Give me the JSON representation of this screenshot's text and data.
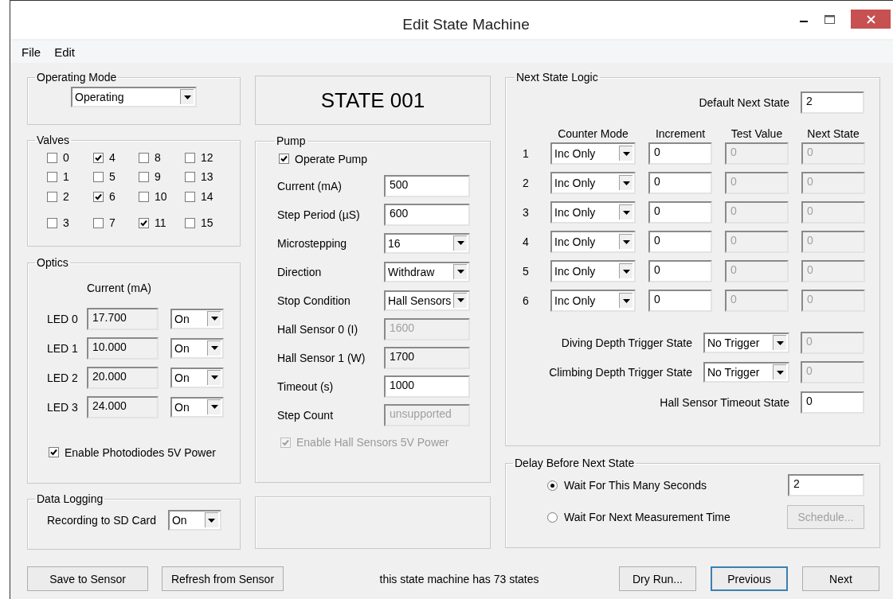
{
  "window": {
    "title": "Edit State Machine"
  },
  "menu": [
    "File",
    "Edit"
  ],
  "operating_mode": {
    "title": "Operating Mode",
    "value": "Operating"
  },
  "valves": {
    "title": "Valves",
    "items": [
      {
        "label": "0",
        "checked": false
      },
      {
        "label": "1",
        "checked": false
      },
      {
        "label": "2",
        "checked": false
      },
      {
        "label": "3",
        "checked": false
      },
      {
        "label": "4",
        "checked": true
      },
      {
        "label": "5",
        "checked": false
      },
      {
        "label": "6",
        "checked": true
      },
      {
        "label": "7",
        "checked": false
      },
      {
        "label": "8",
        "checked": false
      },
      {
        "label": "9",
        "checked": false
      },
      {
        "label": "10",
        "checked": false
      },
      {
        "label": "11",
        "checked": true
      },
      {
        "label": "12",
        "checked": false
      },
      {
        "label": "13",
        "checked": false
      },
      {
        "label": "14",
        "checked": false
      },
      {
        "label": "15",
        "checked": false
      }
    ]
  },
  "optics": {
    "title": "Optics",
    "current_header": "Current (mA)",
    "leds": [
      {
        "label": "LED 0",
        "current": {
          "kind": "readonly",
          "value": "17.700"
        },
        "state": "On"
      },
      {
        "label": "LED 1",
        "current": {
          "kind": "readonly",
          "value": "10.000"
        },
        "state": "On"
      },
      {
        "label": "LED 2",
        "current": {
          "kind": "readonly",
          "value": "20.000"
        },
        "state": "On"
      },
      {
        "label": "LED 3",
        "current": {
          "kind": "readonly",
          "value": "24.000"
        },
        "state": "On"
      }
    ],
    "photodiodes": {
      "label": "Enable Photodiodes 5V Power",
      "checked": true,
      "disabled": false
    }
  },
  "data_logging": {
    "title": "Data Logging",
    "label": "Recording to SD Card",
    "value": "On"
  },
  "state_title": "STATE 001",
  "pump": {
    "title": "Pump",
    "operate": {
      "label": "Operate Pump",
      "checked": true,
      "disabled": false
    },
    "rows": [
      {
        "label": "Current (mA)",
        "control": {
          "kind": "input",
          "value": "500"
        }
      },
      {
        "label": "Step Period  (µS)",
        "control": {
          "kind": "input",
          "value": "600"
        }
      },
      {
        "label": "Microstepping",
        "control": {
          "kind": "dropdown",
          "value": "16"
        }
      },
      {
        "label": "Direction",
        "control": {
          "kind": "dropdown",
          "value": "Withdraw"
        }
      },
      {
        "label": "Stop Condition",
        "control": {
          "kind": "dropdown",
          "value": "Hall Sensors"
        }
      },
      {
        "label": "Hall Sensor 0 (I)",
        "control": {
          "kind": "disabled",
          "value": "1600"
        }
      },
      {
        "label": "Hall Sensor 1 (W)",
        "control": {
          "kind": "readonly",
          "value": "1700"
        }
      },
      {
        "label": "Timeout (s)",
        "control": {
          "kind": "input",
          "value": "1000"
        }
      },
      {
        "label": "Step Count",
        "control": {
          "kind": "disabled",
          "value": "unsupported"
        }
      }
    ],
    "hall_power": {
      "label": "Enable Hall Sensors 5V Power",
      "checked": true,
      "disabled": true
    }
  },
  "next_state_logic": {
    "title": "Next State Logic",
    "default_label": "Default Next State",
    "default_value": {
      "kind": "input",
      "value": "2"
    },
    "columns": [
      "Counter Mode",
      "Increment",
      "Test Value",
      "Next State"
    ],
    "rows": [
      {
        "number": "1",
        "mode": "Inc Only",
        "increment": {
          "kind": "input",
          "value": "0"
        },
        "test_value": {
          "kind": "disabled",
          "value": "0"
        },
        "next_state": {
          "kind": "disabled",
          "value": "0"
        }
      },
      {
        "number": "2",
        "mode": "Inc Only",
        "increment": {
          "kind": "input",
          "value": "0"
        },
        "test_value": {
          "kind": "disabled",
          "value": "0"
        },
        "next_state": {
          "kind": "disabled",
          "value": "0"
        }
      },
      {
        "number": "3",
        "mode": "Inc Only",
        "increment": {
          "kind": "input",
          "value": "0"
        },
        "test_value": {
          "kind": "disabled",
          "value": "0"
        },
        "next_state": {
          "kind": "disabled",
          "value": "0"
        }
      },
      {
        "number": "4",
        "mode": "Inc Only",
        "increment": {
          "kind": "input",
          "value": "0"
        },
        "test_value": {
          "kind": "disabled",
          "value": "0"
        },
        "next_state": {
          "kind": "disabled",
          "value": "0"
        }
      },
      {
        "number": "5",
        "mode": "Inc Only",
        "increment": {
          "kind": "input",
          "value": "0"
        },
        "test_value": {
          "kind": "disabled",
          "value": "0"
        },
        "next_state": {
          "kind": "disabled",
          "value": "0"
        }
      },
      {
        "number": "6",
        "mode": "Inc Only",
        "increment": {
          "kind": "input",
          "value": "0"
        },
        "test_value": {
          "kind": "disabled",
          "value": "0"
        },
        "next_state": {
          "kind": "disabled",
          "value": "0"
        }
      }
    ],
    "triggers": [
      {
        "label": "Diving Depth Trigger State",
        "value": "No Trigger",
        "state": {
          "kind": "disabled",
          "value": "0"
        }
      },
      {
        "label": "Climbing Depth Trigger State",
        "value": "No Trigger",
        "state": {
          "kind": "disabled",
          "value": "0"
        }
      }
    ],
    "timeout_label": "Hall Sensor Timeout State",
    "timeout_value": {
      "kind": "input",
      "value": "0"
    }
  },
  "delay": {
    "title": "Delay Before Next State",
    "options": [
      {
        "label": "Wait For This Many Seconds",
        "selected": true
      },
      {
        "label": "Wait For Next Measurement Time",
        "selected": false
      }
    ],
    "seconds": {
      "kind": "input",
      "value": "2"
    },
    "schedule": {
      "label": "Schedule...",
      "disabled": true
    }
  },
  "footer": {
    "left_buttons": [
      {
        "label": "Save to Sensor",
        "focused": false
      },
      {
        "label": "Refresh from Sensor",
        "focused": false
      }
    ],
    "status": "this state machine has 73 states",
    "right_buttons": [
      {
        "label": "Dry Run...",
        "focused": false
      },
      {
        "label": "Previous",
        "focused": true
      },
      {
        "label": "Next",
        "focused": false
      }
    ]
  }
}
